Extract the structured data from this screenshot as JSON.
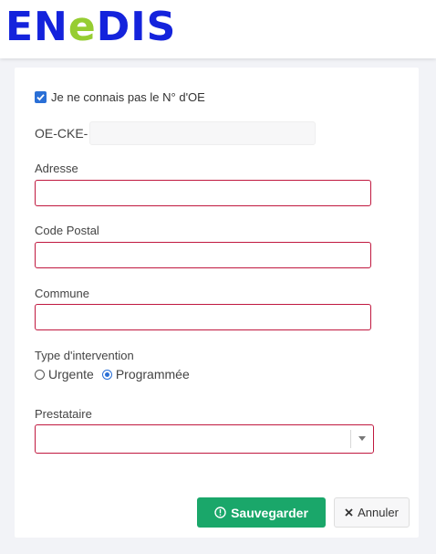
{
  "header": {
    "logo_text_part1": "EN",
    "logo_text_part2": "e",
    "logo_text_part3": "DIS"
  },
  "form": {
    "unknown_oe_checkbox_label": "Je ne connais pas le N° d'OE",
    "unknown_oe_checked": true,
    "oe_prefix": "OE-CKE-",
    "oe_value": "",
    "address_label": "Adresse",
    "address_value": "",
    "postal_code_label": "Code Postal",
    "postal_code_value": "",
    "commune_label": "Commune",
    "commune_value": "",
    "intervention_type_label": "Type d'intervention",
    "intervention_options": [
      {
        "label": "Urgente",
        "selected": false
      },
      {
        "label": "Programmée",
        "selected": true
      }
    ],
    "provider_label": "Prestataire",
    "provider_value": ""
  },
  "actions": {
    "save_label": "Sauvegarder",
    "cancel_label": "Annuler"
  },
  "colors": {
    "brand_blue": "#1423dc",
    "brand_green": "#96cd32",
    "error_border": "#c0183f",
    "save_green": "#1aa76a",
    "checkbox_blue": "#2a6fd6"
  }
}
